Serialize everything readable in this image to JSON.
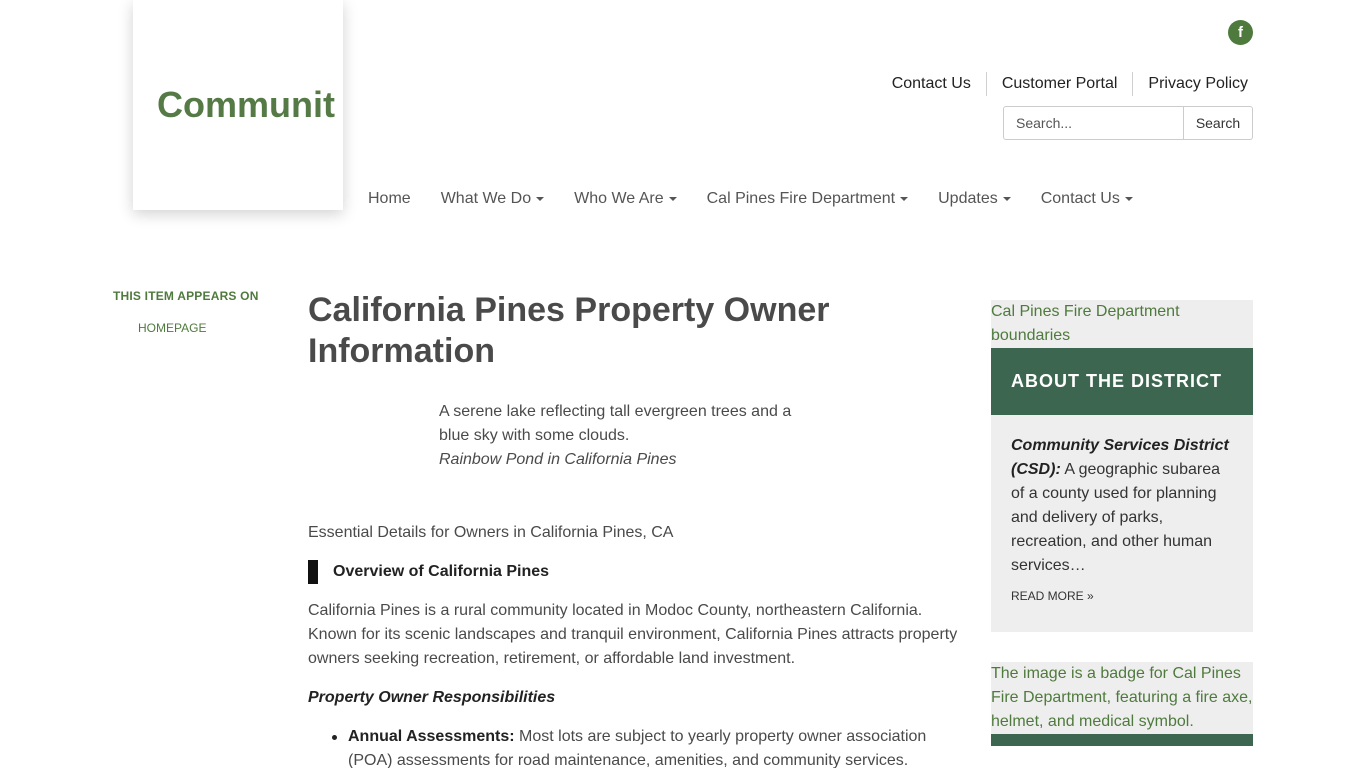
{
  "header": {
    "logo_text": "Communit",
    "social": {
      "icon": "facebook-icon",
      "glyph": "f"
    },
    "utility_nav": [
      "Contact Us",
      "Customer Portal",
      "Privacy Policy"
    ],
    "search": {
      "placeholder": "Search...",
      "button_label": "Search"
    }
  },
  "main_nav": [
    {
      "label": "Home",
      "dropdown": false
    },
    {
      "label": "What We Do",
      "dropdown": true
    },
    {
      "label": "Who We Are",
      "dropdown": true
    },
    {
      "label": "Cal Pines Fire Department",
      "dropdown": true
    },
    {
      "label": "Updates",
      "dropdown": true
    },
    {
      "label": "Contact Us",
      "dropdown": true
    }
  ],
  "left_sidebar": {
    "title": "THIS ITEM APPEARS ON",
    "link": "HOMEPAGE"
  },
  "article": {
    "title": "California Pines Property Owner Information",
    "figure_alt": "A serene lake reflecting tall evergreen trees and a blue sky with some clouds.",
    "figure_caption": "Rainbow Pond in California Pines",
    "intro": "Essential Details for Owners in California Pines, CA",
    "overview_heading": "Overview of California Pines",
    "overview_text": "California Pines is a rural community located in Modoc County, northeastern California. Known for its scenic landscapes and tranquil environment, California Pines attracts property owners seeking recreation, retirement, or affordable land investment.",
    "responsibilities_heading": "Property Owner Responsibilities",
    "responsibilities": [
      {
        "term": "Annual Assessments:",
        "text": " Most lots are subject to yearly property owner association (POA) assessments for road maintenance, amenities, and community services."
      }
    ]
  },
  "right_sidebar": {
    "card1": {
      "image_alt": "Cal Pines Fire Department boundaries",
      "heading": "ABOUT THE DISTRICT",
      "term": "Community Services District (CSD):",
      "text": " A geographic subarea of a county used for planning and delivery of parks, recreation, and other human services…",
      "read_more": "READ MORE »"
    },
    "card2": {
      "image_alt": "The image is a badge for Cal Pines Fire Department, featuring a fire axe, helmet, and medical symbol."
    }
  },
  "colors": {
    "brand_green": "#557a46",
    "link_green": "#4f7a3d",
    "sidebar_header": "#3d6650",
    "sidebar_bg": "#eeeeee"
  }
}
